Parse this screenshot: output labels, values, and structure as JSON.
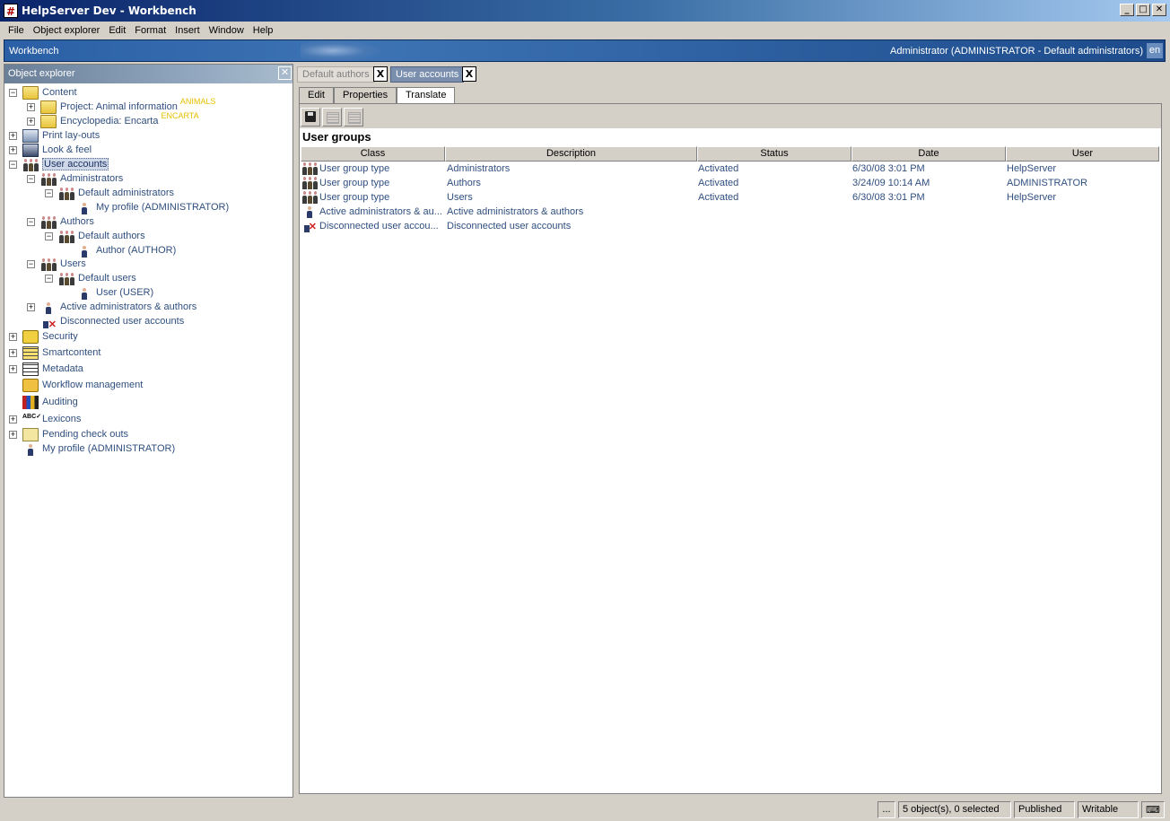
{
  "window": {
    "title": "HelpServer Dev - Workbench",
    "icon_glyph": "#"
  },
  "menu": [
    "File",
    "Object explorer",
    "Edit",
    "Format",
    "Insert",
    "Window",
    "Help"
  ],
  "banner": {
    "title": "Workbench",
    "user": "Administrator (ADMINISTRATOR - Default administrators)",
    "lang": "en"
  },
  "explorer": {
    "title": "Object explorer",
    "tree": {
      "content": "Content",
      "project": "Project: Animal information",
      "project_tag": "ANIMALS",
      "encyclopedia": "Encyclopedia: Encarta",
      "encyclopedia_tag": "ENCARTA",
      "print": "Print lay-outs",
      "look": "Look & feel",
      "user_accounts": "User accounts",
      "administrators": "Administrators",
      "default_administrators": "Default administrators",
      "my_profile_admin": "My profile (ADMINISTRATOR)",
      "authors": "Authors",
      "default_authors": "Default authors",
      "author": "Author (AUTHOR)",
      "users": "Users",
      "default_users": "Default users",
      "user": "User (USER)",
      "active": "Active administrators & authors",
      "disconnected": "Disconnected user accounts",
      "security": "Security",
      "smartcontent": "Smartcontent",
      "metadata": "Metadata",
      "workflow": "Workflow management",
      "auditing": "Auditing",
      "lexicons": "Lexicons",
      "pending": "Pending check outs",
      "my_profile": "My profile (ADMINISTRATOR)"
    }
  },
  "doc_tabs": [
    {
      "label": "Default authors",
      "close": "X"
    },
    {
      "label": "User accounts",
      "close": "X"
    }
  ],
  "sub_tabs": [
    "Edit",
    "Properties",
    "Translate"
  ],
  "section_title": "User groups",
  "table": {
    "columns": [
      "Class",
      "Description",
      "Status",
      "Date",
      "User"
    ],
    "rows": [
      {
        "class": "User group type",
        "description": "Administrators",
        "status": "Activated",
        "date": "6/30/08 3:01 PM",
        "user": "HelpServer"
      },
      {
        "class": "User group type",
        "description": "Authors",
        "status": "Activated",
        "date": "3/24/09 10:14 AM",
        "user": "ADMINISTRATOR"
      },
      {
        "class": "User group type",
        "description": "Users",
        "status": "Activated",
        "date": "6/30/08 3:01 PM",
        "user": "HelpServer"
      },
      {
        "class": "Active administrators & au...",
        "description": "Active administrators & authors",
        "status": "",
        "date": "",
        "user": ""
      },
      {
        "class": "Disconnected user accou...",
        "description": "Disconnected user accounts",
        "status": "",
        "date": "",
        "user": ""
      }
    ]
  },
  "status": {
    "more": "...",
    "count": "5 object(s), 0 selected",
    "state": "Published",
    "mode": "Writable"
  },
  "colors": {
    "link_text": "#2f4f7f",
    "tag_yellow": "#e8c000",
    "banner_blue": "#2a5fa5"
  }
}
